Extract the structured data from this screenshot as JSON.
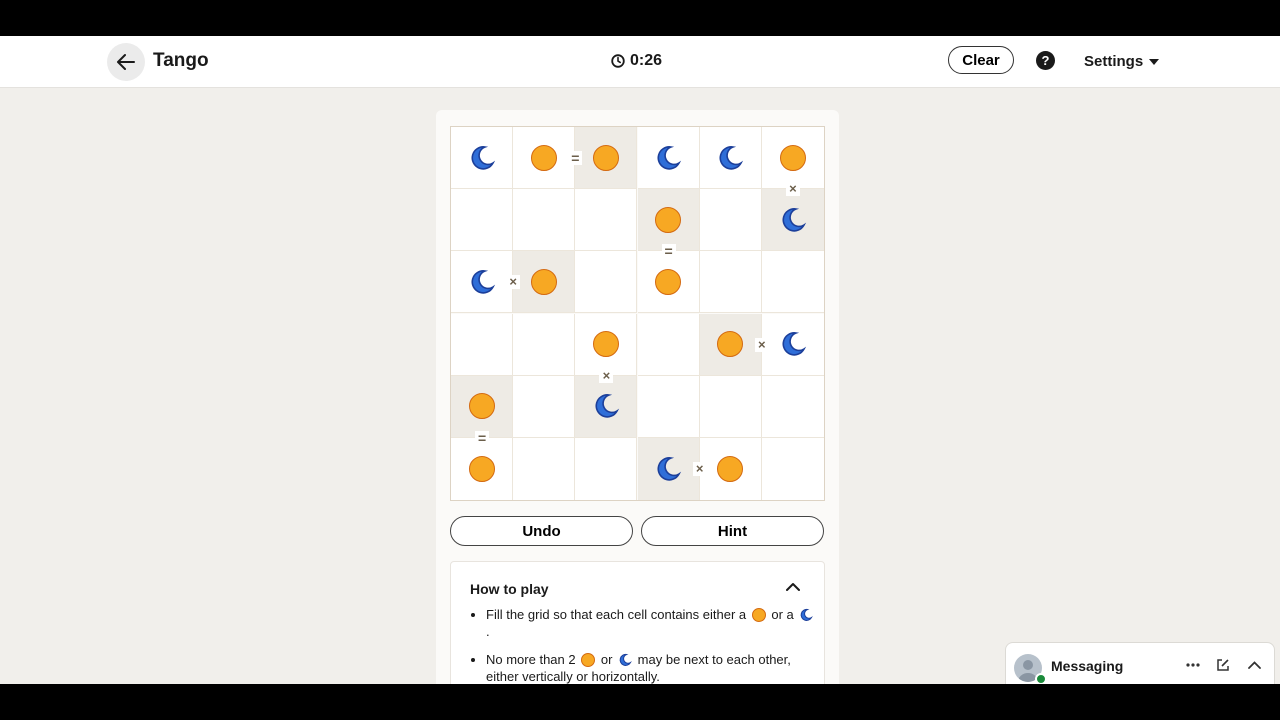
{
  "header": {
    "title": "Tango",
    "timer": "0:26",
    "clear_label": "Clear",
    "help_label": "?",
    "settings_label": "Settings"
  },
  "colors": {
    "sun_fill": "#f7a823",
    "sun_stroke": "#d46a10",
    "moon_fill": "#2f6ed8",
    "moon_stroke": "#1c3f9a",
    "locked_cell": "#eeebe5"
  },
  "board": {
    "size": 6,
    "cells": [
      [
        "moon",
        "sun",
        "sun",
        "moon",
        "moon",
        "sun"
      ],
      [
        "",
        "",
        "",
        "sun",
        "",
        "moon"
      ],
      [
        "moon",
        "sun",
        "",
        "sun",
        "",
        ""
      ],
      [
        "",
        "",
        "sun",
        "",
        "sun",
        "moon"
      ],
      [
        "sun",
        "",
        "moon",
        "",
        "",
        ""
      ],
      [
        "sun",
        "",
        "",
        "moon",
        "sun",
        ""
      ]
    ],
    "locked": [
      [
        false,
        false,
        true,
        false,
        false,
        false
      ],
      [
        false,
        false,
        false,
        true,
        false,
        true
      ],
      [
        false,
        true,
        false,
        false,
        false,
        false
      ],
      [
        false,
        false,
        false,
        false,
        true,
        false
      ],
      [
        true,
        false,
        true,
        false,
        false,
        false
      ],
      [
        false,
        false,
        false,
        true,
        false,
        false
      ]
    ],
    "constraints": [
      {
        "row": 0,
        "col": 1,
        "dir": "right",
        "symbol": "="
      },
      {
        "row": 0,
        "col": 5,
        "dir": "down",
        "symbol": "×"
      },
      {
        "row": 1,
        "col": 3,
        "dir": "down",
        "symbol": "="
      },
      {
        "row": 2,
        "col": 0,
        "dir": "right",
        "symbol": "×"
      },
      {
        "row": 3,
        "col": 4,
        "dir": "right",
        "symbol": "×"
      },
      {
        "row": 3,
        "col": 2,
        "dir": "down",
        "symbol": "×"
      },
      {
        "row": 4,
        "col": 0,
        "dir": "down",
        "symbol": "="
      },
      {
        "row": 5,
        "col": 3,
        "dir": "right",
        "symbol": "×"
      }
    ]
  },
  "controls": {
    "undo_label": "Undo",
    "hint_label": "Hint"
  },
  "how_to_play": {
    "title": "How to play",
    "rule1_a": "Fill the grid so that each cell contains either a",
    "rule1_b": "or a",
    "rule1_c": ".",
    "rule2_a": "No more than 2",
    "rule2_b": "or",
    "rule2_c": "may be next to each other, either vertically or horizontally."
  },
  "messaging": {
    "label": "Messaging"
  }
}
